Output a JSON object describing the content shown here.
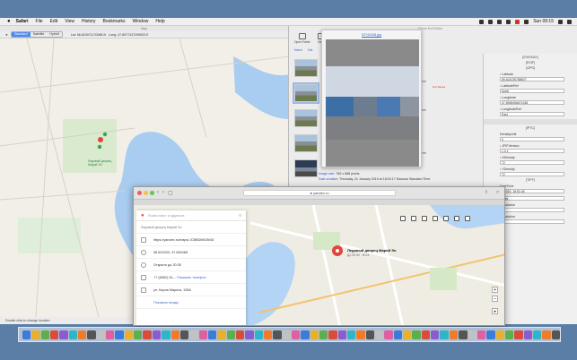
{
  "menubar": {
    "app": "Safari",
    "items": [
      "File",
      "Edit",
      "View",
      "History",
      "Bookmarks",
      "Window",
      "Help"
    ],
    "clock": "Sun 09:15"
  },
  "maps": {
    "title": "Map",
    "view_modes": [
      "Standard",
      "Satellite",
      "Hybrid"
    ],
    "selected_mode": "Standard",
    "lat_label": "Lat: 56.624071170086 N",
    "long_label": "Long: 47.8977437209003 E",
    "status": "Double click to change location",
    "place_label": "Ледовый дворец Марий Эл"
  },
  "editor": {
    "title": "Photo Exif Editor",
    "toolbar": [
      "Open Folder",
      "Save"
    ],
    "tabs": [
      "Name",
      "Dat"
    ],
    "list_times": [
      "Standard Time",
      "Standard Time",
      "Standard Time"
    ],
    "red_label": "Not Saved",
    "image_size_label": "Image size:",
    "image_size_value": "765 x 588 pixels",
    "date_created_label": "Date creation:",
    "date_created_value": "Thursday, 31 January 2019 at 18:02:17 Moscow Standard Time"
  },
  "preview": {
    "filename": "52742448.jpg"
  },
  "exif": {
    "sections": [
      "[EXIFAUX]",
      "[EXIF]",
      "[GPS]",
      "[IPTC]",
      "[TIFF]"
    ],
    "gps_fields": [
      {
        "label": "Latitude",
        "value": "56.62423578860T",
        "marker": "green"
      },
      {
        "label": "LatitudeRef",
        "value": "North",
        "marker": "green"
      },
      {
        "label": "Longitude",
        "value": "47.8948456674248",
        "marker": "green"
      },
      {
        "label": "LongitudeRef",
        "value": "East",
        "marker": "green"
      }
    ],
    "other_fields": [
      {
        "label": "DensityUnit",
        "value": "0",
        "marker": "none"
      },
      {
        "label": "JFIFVersion",
        "value": "1.0.1",
        "marker": "red"
      },
      {
        "label": "XDensity",
        "value": "72",
        "marker": "red"
      },
      {
        "label": "YDensity",
        "value": "72",
        "marker": "red"
      }
    ],
    "tiff_fields": [
      {
        "label": "DateTime",
        "value": "1/2019, 18:51:08"
      },
      {
        "label": "",
        "value": "ches"
      },
      {
        "label": "Resolution",
        "value": "72"
      },
      {
        "label": "Resolution",
        "value": "72"
      }
    ]
  },
  "safari": {
    "url": "yandex.ru",
    "tab_label": "",
    "search_placeholder": "Поиск мест и адресов",
    "place_name": "Ледовый дворец Марий Эл",
    "place_sub": "До 20:30 · ★4.5",
    "rows": [
      {
        "icon": "link",
        "text": "https://yandex.ru/maps/-/CBBDM0Ok5D",
        "kind": "normal"
      },
      {
        "icon": "pin",
        "text": "56.624203, 47.894468",
        "kind": "normal"
      },
      {
        "icon": "clock",
        "text": "Открыто до 20:30",
        "kind": "normal"
      },
      {
        "icon": "phone",
        "text": "+7 (8362) 31-..",
        "extra": "Показать телефон",
        "kind": "link"
      },
      {
        "icon": "home",
        "text": "ул. Карла Маркса, 105А",
        "kind": "normal"
      },
      {
        "icon": "",
        "text": "Показать входы",
        "kind": "link"
      }
    ]
  },
  "dock": {
    "count": 58
  }
}
